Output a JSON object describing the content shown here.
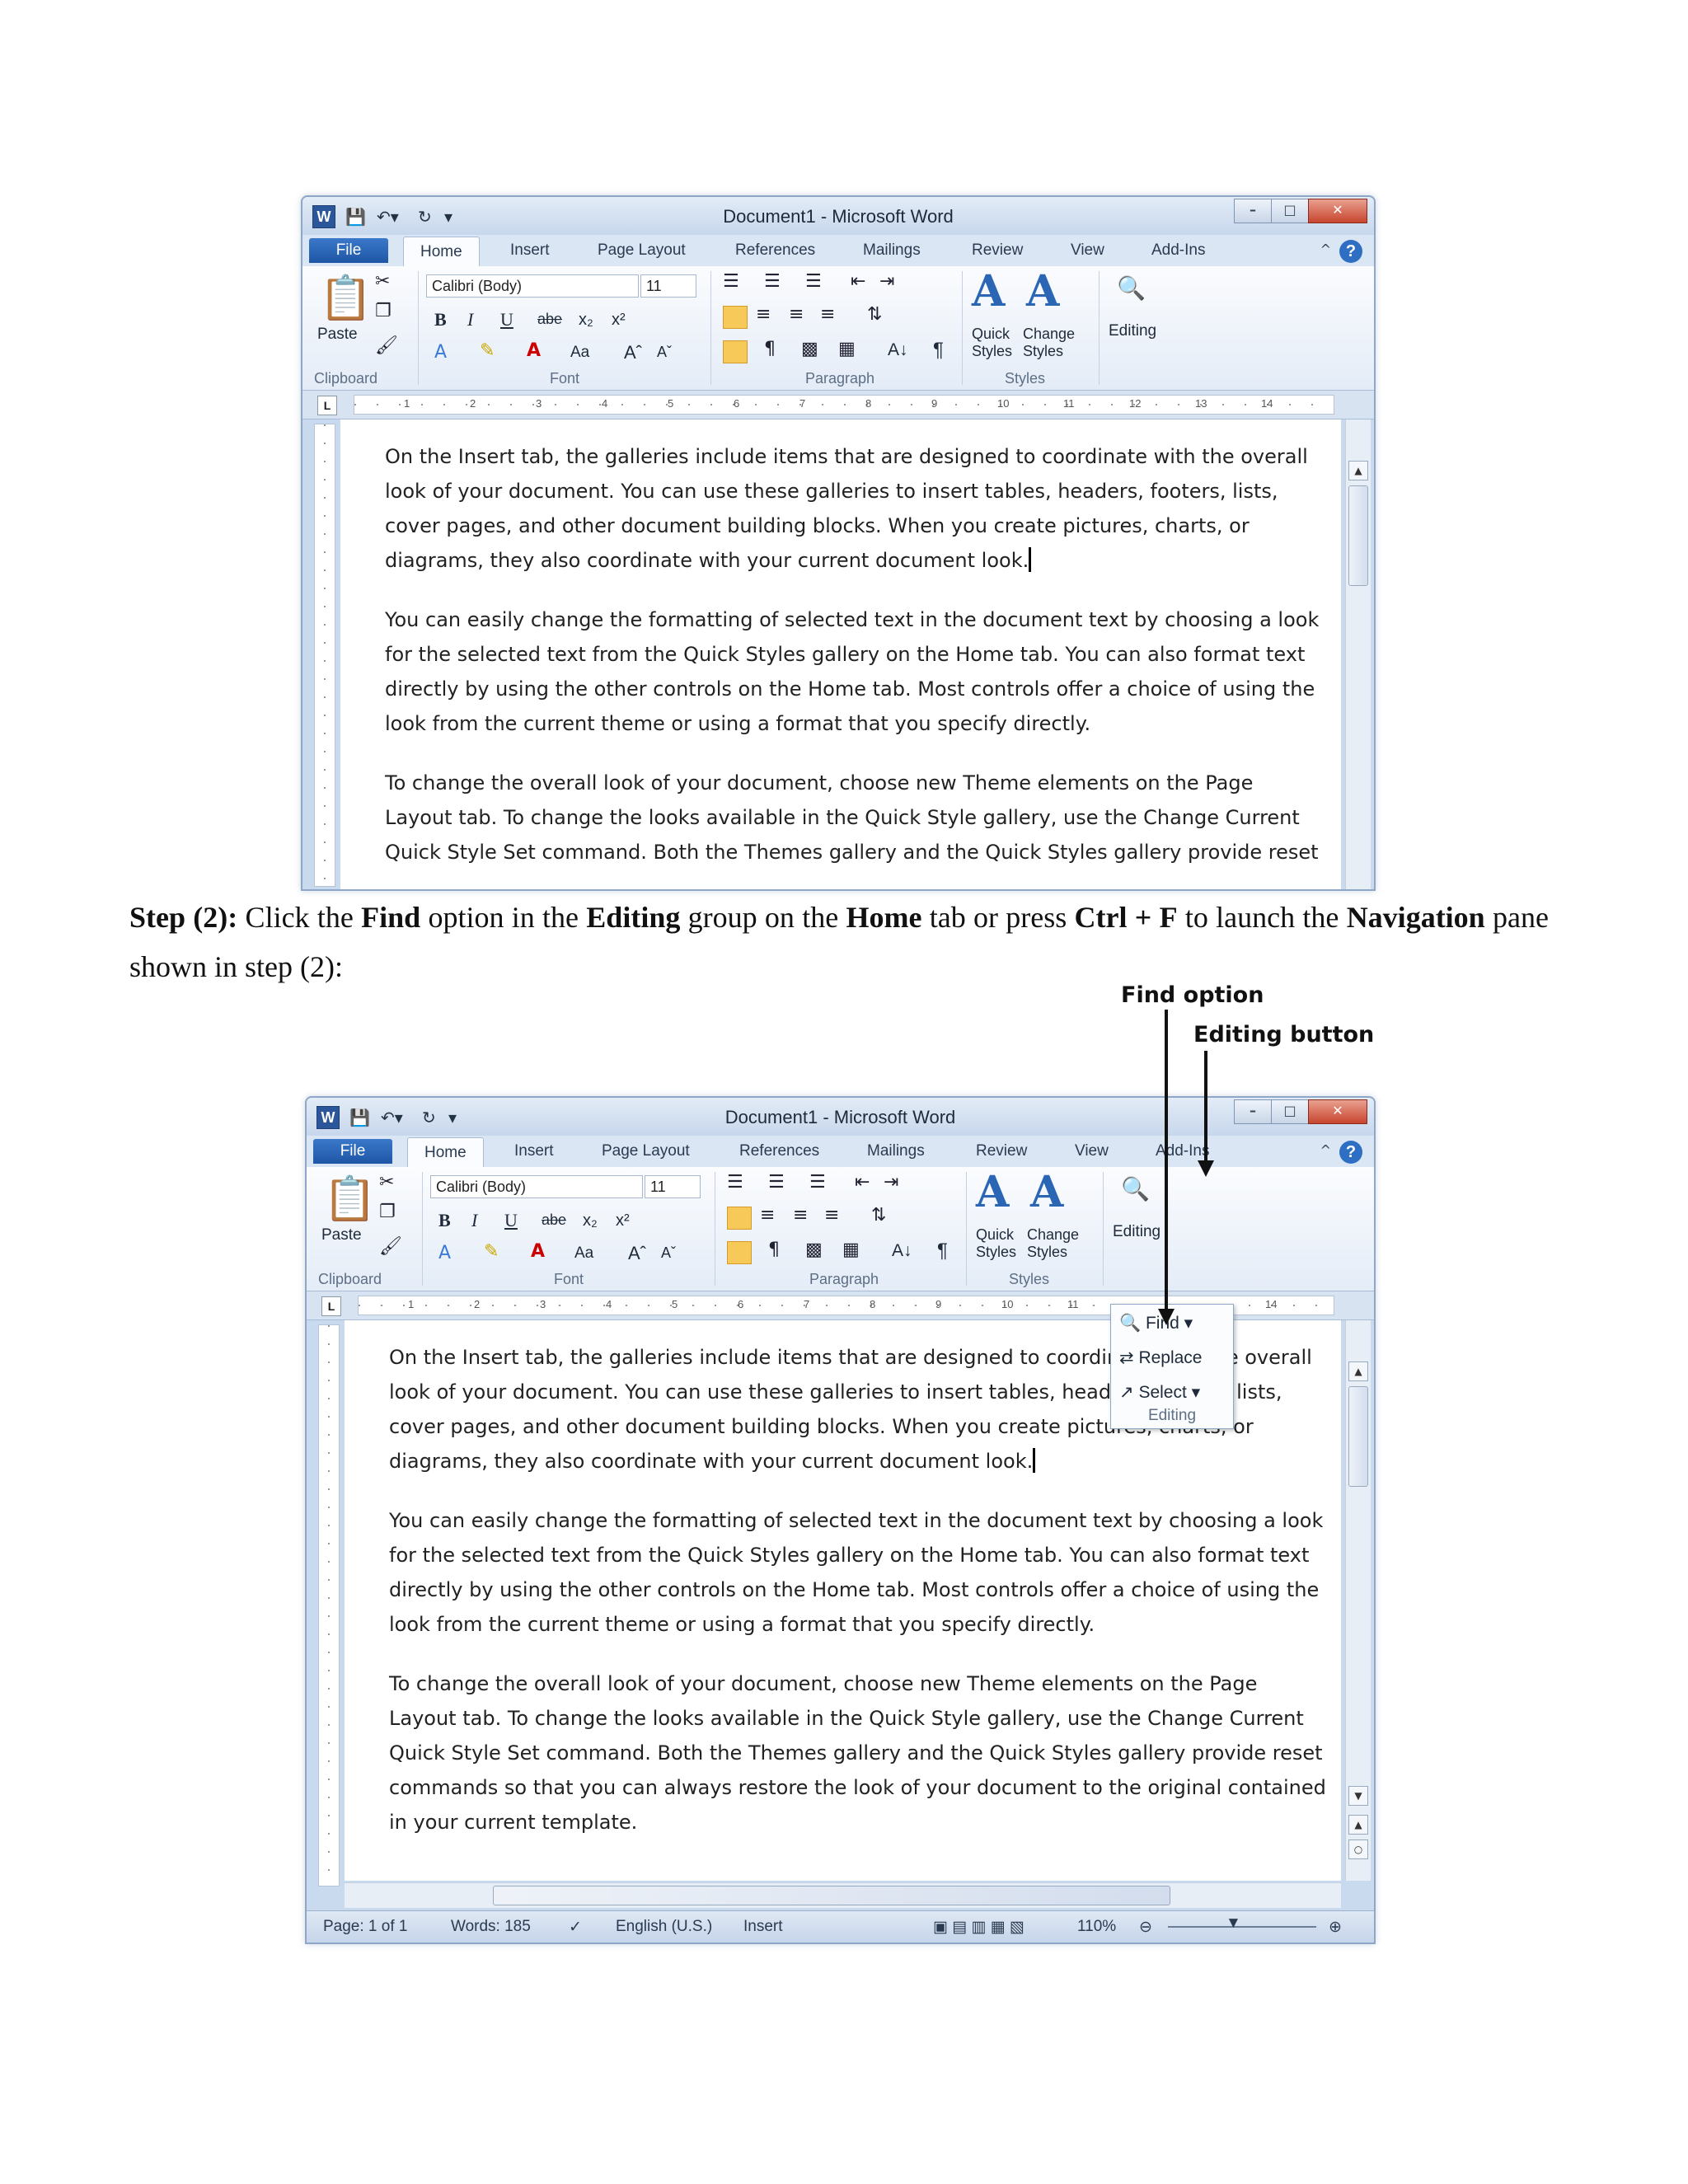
{
  "window": {
    "title": "Document1  -  Microsoft Word",
    "logo": "W",
    "tabs": [
      "File",
      "Home",
      "Insert",
      "Page Layout",
      "References",
      "Mailings",
      "Review",
      "View",
      "Add-Ins"
    ],
    "help": "?"
  },
  "ribbon": {
    "paste": "Paste",
    "font_name": "Calibri (Body)",
    "font_size": "11",
    "bold": "B",
    "italic": "I",
    "underline": "U",
    "strike": "abe",
    "sub": "x₂",
    "sup": "x²",
    "grow": "Aˆ",
    "shrink": "Aˇ",
    "case": "Aa",
    "pilcrow": "¶",
    "sort": "A↓",
    "quick_styles": "Quick\nStyles",
    "change_styles": "Change\nStyles",
    "editing": "Editing",
    "groups": {
      "clipboard": "Clipboard",
      "font": "Font",
      "paragraph": "Paragraph",
      "styles": "Styles"
    }
  },
  "ruler_ticks": [
    "1",
    "2",
    "3",
    "4",
    "5",
    "6",
    "7",
    "8",
    "9",
    "10",
    "11",
    "12",
    "13",
    "14"
  ],
  "document": {
    "paragraphs": [
      "On the Insert tab, the galleries include items that are designed to coordinate with the overall look of your document. You can use these galleries to insert tables, headers, footers, lists, cover pages, and other document building blocks. When you create pictures, charts, or diagrams, they also coordinate with your current document look.",
      "You can easily change the formatting of selected text in the document text by choosing a look for the selected text from the Quick Styles gallery on the Home tab. You can also format text directly by using the other controls on the Home tab. Most controls offer a choice of using the look from the current theme or using a format that you specify directly.",
      "To change the overall look of your document, choose new Theme elements on the Page Layout tab. To change the looks available in the Quick Style gallery, use the Change Current Quick Style Set command. Both the Themes gallery and the Quick Styles gallery provide reset",
      "commands so that you can always restore the look of your document to the original contained in your current template."
    ]
  },
  "step": {
    "label": "Step (2):",
    "t1": " Click the ",
    "find": "Find",
    "t2": " option in the ",
    "editing": "Editing",
    "t3": " group on the ",
    "home": "Home",
    "t4": " tab or press ",
    "shortcut": "Ctrl + F",
    "t5": " to launch the ",
    "navigation": "Navigation",
    "t6": " pane shown in step (2):"
  },
  "callouts": {
    "find_option": "Find option",
    "editing_button": "Editing button"
  },
  "editing_menu": {
    "find": "Find",
    "replace": "Replace",
    "select": "Select",
    "group": "Editing"
  },
  "statusbar": {
    "page": "Page: 1 of 1",
    "words": "Words: 185",
    "language": "English (U.S.)",
    "mode": "Insert",
    "zoom": "110%"
  }
}
